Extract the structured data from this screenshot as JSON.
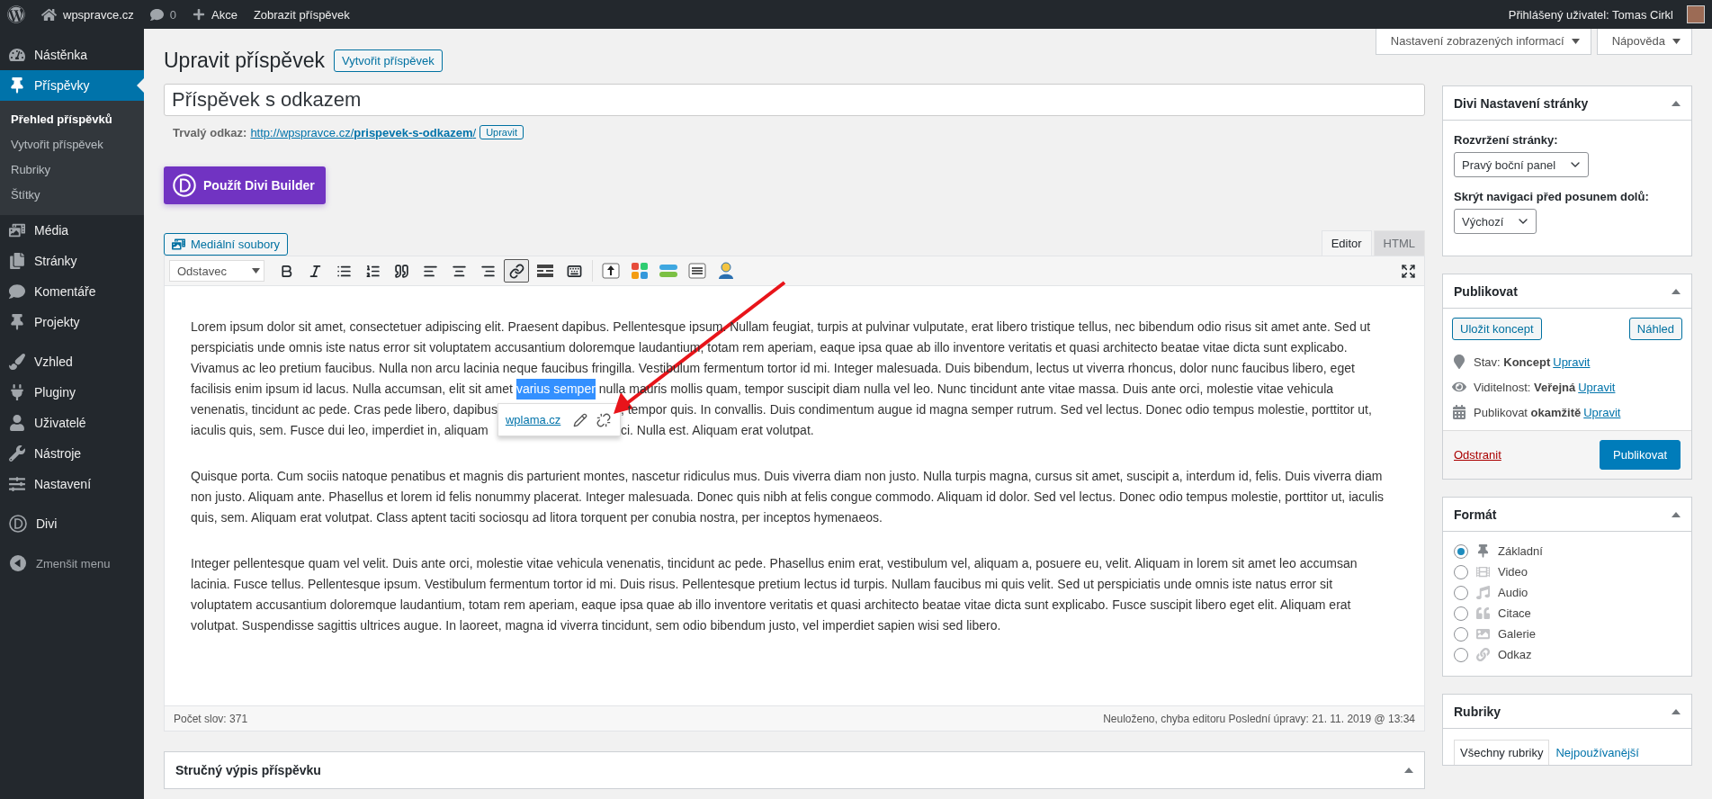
{
  "admin_bar": {
    "site": "wpspravce.cz",
    "comments": "0",
    "new": "Akce",
    "view": "Zobrazit příspěvek",
    "user": "Přihlášený uživatel: Tomas Cirkl"
  },
  "menu": [
    {
      "items": [
        {
          "label": "Nástěnka",
          "selected": false
        },
        {
          "label": "Příspěvky",
          "selected": true,
          "children": [
            {
              "label": "Přehled příspěvků",
              "selected": true
            },
            {
              "label": "Vytvořit příspěvek",
              "selected": false
            },
            {
              "label": "Rubriky",
              "selected": false
            },
            {
              "label": "Štítky",
              "selected": false
            }
          ]
        },
        {
          "label": "Média",
          "selected": false
        },
        {
          "label": "Stránky",
          "selected": false
        },
        {
          "label": "Komentáře",
          "selected": false
        },
        {
          "label": "Projekty",
          "selected": false
        }
      ]
    },
    {
      "items": [
        {
          "label": "Vzhled",
          "selected": false
        },
        {
          "label": "Pluginy",
          "selected": false
        },
        {
          "label": "Uživatelé",
          "selected": false
        },
        {
          "label": "Nástroje",
          "selected": false
        },
        {
          "label": "Nastavení",
          "selected": false
        }
      ]
    },
    {
      "items": [
        {
          "label": "Divi",
          "selected": false
        }
      ]
    }
  ],
  "collapse_menu": "Zmenšit menu",
  "screen_options": [
    "Nastavení zobrazených informací",
    "Nápověda"
  ],
  "heading": "Upravit příspěvek",
  "add_new": "Vytvořit příspěvek",
  "title_value": "Příspěvek s odkazem",
  "permalink": {
    "label": "Trvalý odkaz:",
    "url": "http://wpspravce.cz/**prispevek-s-odkazem**/",
    "edit": "Upravit"
  },
  "divi_button": "Použít Divi Builder",
  "media_button": "Mediální soubory",
  "editor_tabs": [
    {
      "label": "Editor",
      "selected": true
    },
    {
      "label": "HTML",
      "selected": false
    }
  ],
  "toolbar": {
    "format": "Odstavec",
    "buttons": [
      {
        "active": false
      },
      {
        "active": false
      },
      {
        "active": false
      },
      {
        "active": false
      },
      {
        "active": false
      },
      {
        "active": false
      },
      {
        "active": false
      },
      {
        "active": false
      },
      {
        "active": true
      },
      {
        "active": false
      },
      {
        "active": false
      }
    ]
  },
  "editor": {
    "paragraphs": [
      {
        "lines": [
          [
            {
              "text": "Lorem ipsum dolor sit amet, consectetuer adipiscing elit. Praesent dapibus. Pellentesque ipsum. Nullam feugiat, turpis at pulvinar vulputate, erat libero tristique tellus, nec bibendum odio risus sit amet ante. Sed ut",
              "selected": false
            }
          ],
          [
            {
              "text": "perspiciatis unde omnis iste natus error sit voluptatem accusantium doloremque laudantium, totam rem aperiam, eaque ipsa quae ab illo inventore veritatis et quasi architecto beatae vitae dicta sunt explicabo.",
              "selected": false
            }
          ],
          [
            {
              "text": "Vivamus ac leo pretium faucibus. Nulla non arcu lacinia neque faucibus fringilla. Vestibulum fermentum tortor id mi. Integer malesuada. Duis bibendum, lectus ut viverra rhoncus, dolor nunc faucibus libero, eget",
              "selected": false
            }
          ],
          [
            {
              "text": "facilisis enim ipsum id lacus. Nulla accumsan, elit sit amet",
              "selected": false
            },
            {
              "text": "varius semper",
              "selected": true
            },
            {
              "text": "nulla mauris mollis quam, tempor suscipit diam nulla vel leo. Nunc tincidunt ante vitae massa. Duis ante orci, molestie vitae vehicula",
              "selected": false
            }
          ]
        ],
        "split_lines": {
          "left": [
            "venenatis, tincidunt ac pede. Cras pede libero, dapibus",
            "iaculis quis, sem. Fusce dui leo, imperdiet in, aliquam"
          ],
          "right": [
            ", tempor quis. In convallis. Duis condimentum augue id magna semper rutrum. Sed vel lectus. Donec odio tempus molestie, porttitor ut,",
            "ci. Nulla est. Aliquam erat volutpat."
          ]
        }
      },
      {
        "lines": [
          [
            {
              "text": "Quisque porta. Cum sociis natoque penatibus et magnis dis parturient montes, nascetur ridiculus mus. Duis viverra diam non justo. Nulla turpis magna, cursus sit amet, suscipit a, interdum id, felis. Duis viverra diam",
              "selected": false
            }
          ],
          [
            {
              "text": "non justo. Aliquam ante. Phasellus et lorem id felis nonummy placerat. Integer malesuada. Donec quis nibh at felis congue commodo. Aliquam id dolor. Sed vel lectus. Donec odio tempus molestie, porttitor ut, iaculis",
              "selected": false
            }
          ],
          [
            {
              "text": "quis, sem. Aliquam erat volutpat. Class aptent taciti sociosqu ad litora torquent per conubia nostra, per inceptos hymenaeos.",
              "selected": false
            }
          ]
        ]
      },
      {
        "lines": [
          [
            {
              "text": "Integer pellentesque quam vel velit. Duis ante orci, molestie vitae vehicula venenatis, tincidunt ac pede. Phasellus enim erat, vestibulum vel, aliquam a, posuere eu, velit. Aliquam in lorem sit amet leo accumsan",
              "selected": false
            }
          ],
          [
            {
              "text": "lacinia. Fusce tellus. Pellentesque ipsum. Vestibulum fermentum tortor id mi. Duis risus. Pellentesque pretium lectus id turpis. Nullam faucibus mi quis velit. Sed ut perspiciatis unde omnis iste natus error sit",
              "selected": false
            }
          ],
          [
            {
              "text": "voluptatem accusantium doloremque laudantium, totam rem aperiam, eaque ipsa quae ab illo inventore veritatis et quasi architecto beatae vitae dicta sunt explicabo. Fusce suscipit libero eget elit. Aliquam erat",
              "selected": false
            }
          ],
          [
            {
              "text": "volutpat. Suspendisse sagittis ultrices augue. In laoreet, magna id viverra tincidunt, sem odio bibendum justo, vel imperdiet sapien wisi sed libero.",
              "selected": false
            }
          ]
        ]
      }
    ],
    "link_popup": {
      "url": "wplama.cz"
    }
  },
  "status": {
    "words": "Počet slov: 371",
    "saved": "Neuloženo, chyba editoru Poslední úpravy: 21. 11. 2019 @ 13:34"
  },
  "excerpt_box": {
    "title": "Stručný výpis příspěvku"
  },
  "side": {
    "divi": {
      "title": "Divi Nastavení stránky",
      "fields": [
        {
          "label": "Rozvržení stránky:",
          "value": "Pravý boční panel"
        },
        {
          "label": "Skrýt navigaci před posunem dolů:",
          "value": "Výchozí"
        }
      ]
    },
    "publish": {
      "title": "Publikovat",
      "save": "Uložit koncept",
      "preview": "Náhled",
      "rows": [
        {
          "text": "Stav: **Koncept**",
          "link": "Upravit"
        },
        {
          "text": "Viditelnost: **Veřejná**",
          "link": "Upravit"
        },
        {
          "text": "Publikovat **okamžitě**",
          "link": "Upravit"
        }
      ],
      "delete": "Odstranit",
      "publish": "Publikovat"
    },
    "format": {
      "title": "Formát",
      "options": [
        {
          "label": "Základní",
          "selected": true
        },
        {
          "label": "Video",
          "selected": false
        },
        {
          "label": "Audio",
          "selected": false
        },
        {
          "label": "Citace",
          "selected": false
        },
        {
          "label": "Galerie",
          "selected": false
        },
        {
          "label": "Odkaz",
          "selected": false
        }
      ]
    },
    "categories": {
      "title": "Rubriky",
      "tabs": [
        {
          "label": "Všechny rubriky",
          "selected": true
        },
        {
          "label": "Nejpoužívanější",
          "selected": false
        }
      ]
    }
  }
}
